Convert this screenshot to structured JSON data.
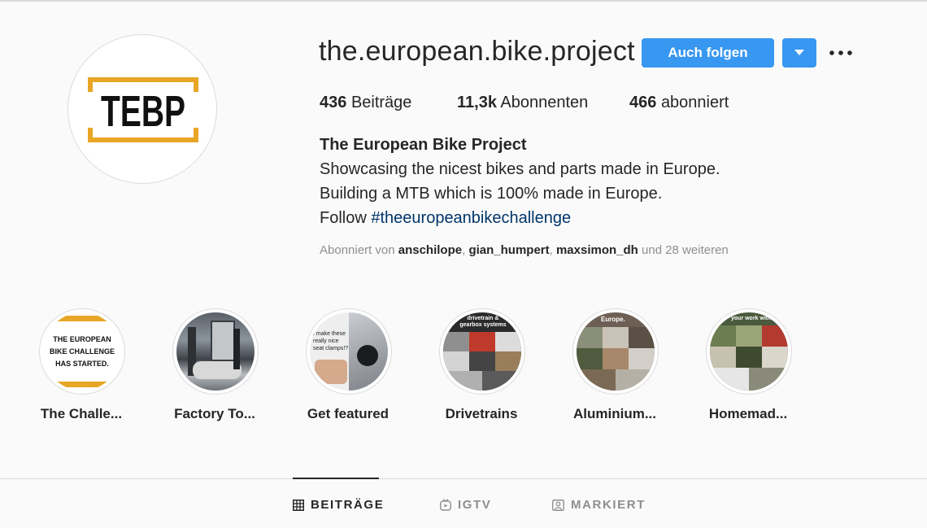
{
  "profile": {
    "username": "the.european.bike.project",
    "avatar_text": "TEBP",
    "follow_label": "Auch folgen",
    "stats": {
      "posts_count": "436",
      "posts_label": "Beiträge",
      "followers_count": "11,3k",
      "followers_label": "Abonnenten",
      "following_count": "466",
      "following_label": "abonniert"
    },
    "bio": {
      "name": "The European Bike Project",
      "line1": "Showcasing the nicest bikes and parts made in Europe.",
      "line2": "Building a MTB which is 100% made in Europe.",
      "line3_prefix": "Follow ",
      "hashtag": "#theeuropeanbikechallenge"
    },
    "followed_by": {
      "prefix": "Abonniert von ",
      "users": [
        "anschilope",
        "gian_humpert",
        "maxsimon_dh"
      ],
      "separator": ", ",
      "suffix": " und 28 weiteren"
    }
  },
  "highlights": [
    {
      "label": "The Challe...",
      "thumb_text": "THE EUROPEAN BIKE CHALLENGE HAS STARTED."
    },
    {
      "label": "Factory To..."
    },
    {
      "label": "Get featured",
      "thumb_text": "I make these really nice seat clamps!?"
    },
    {
      "label": "Drivetrains",
      "thumb_text": "drivetrain & gearbox systems"
    },
    {
      "label": "Aluminium...",
      "thumb_text": "Europe."
    },
    {
      "label": "Homemad...",
      "thumb_text": "your work with us"
    }
  ],
  "tabs": [
    {
      "label": "BEITRÄGE",
      "icon": "grid-icon",
      "active": true
    },
    {
      "label": "IGTV",
      "icon": "igtv-icon",
      "active": false
    },
    {
      "label": "MARKIERT",
      "icon": "tagged-icon",
      "active": false
    }
  ],
  "colors": {
    "accent": "#3897f0",
    "hashtag": "#003569",
    "muted": "#8e8e8e",
    "logo_bracket": "#e8a626"
  }
}
